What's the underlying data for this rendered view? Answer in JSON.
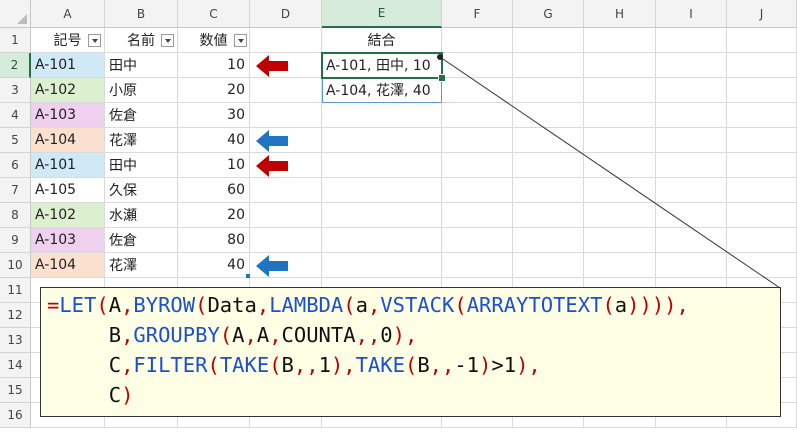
{
  "columns": [
    "A",
    "B",
    "C",
    "D",
    "E",
    "F",
    "G",
    "H",
    "I",
    "J"
  ],
  "selected_column": "E",
  "rows": [
    "1",
    "2",
    "3",
    "4",
    "5",
    "6",
    "7",
    "8",
    "9",
    "10",
    "11",
    "12",
    "13",
    "14",
    "15",
    "16"
  ],
  "selected_row": "2",
  "headers": {
    "a": "記号",
    "b": "名前",
    "c": "数値",
    "e": "結合"
  },
  "data_rows": [
    {
      "a": "A-101",
      "b": "田中",
      "c": "10"
    },
    {
      "a": "A-102",
      "b": "小原",
      "c": "20"
    },
    {
      "a": "A-103",
      "b": "佐倉",
      "c": "30"
    },
    {
      "a": "A-104",
      "b": "花澤",
      "c": "40"
    },
    {
      "a": "A-101",
      "b": "田中",
      "c": "10"
    },
    {
      "a": "A-105",
      "b": "久保",
      "c": "60"
    },
    {
      "a": "A-102",
      "b": "水瀬",
      "c": "20"
    },
    {
      "a": "A-103",
      "b": "佐倉",
      "c": "80"
    },
    {
      "a": "A-104",
      "b": "花澤",
      "c": "40"
    }
  ],
  "result": [
    "A-101, 田中, 10",
    "A-104, 花澤, 40"
  ],
  "colors": {
    "A-101": "#cfe9f6",
    "A-102": "#dcefcf",
    "A-103": "#efd0ee",
    "A-104": "#fbe0d0",
    "A-105": "#ffffff",
    "red_arrow": "#c00000",
    "blue_arrow": "#1f75c4",
    "accent": "#217346"
  },
  "formula_lines": [
    [
      [
        "p",
        "="
      ],
      [
        "f",
        "LET"
      ],
      [
        "p",
        "("
      ],
      [
        "t",
        "A"
      ],
      [
        "p",
        ","
      ],
      [
        "f",
        "BYROW"
      ],
      [
        "p",
        "("
      ],
      [
        "t",
        "Data"
      ],
      [
        "p",
        ","
      ],
      [
        "f",
        "LAMBDA"
      ],
      [
        "p",
        "("
      ],
      [
        "t",
        "a"
      ],
      [
        "p",
        ","
      ],
      [
        "f",
        "VSTACK"
      ],
      [
        "p",
        "("
      ],
      [
        "f",
        "ARRAYTOTEXT"
      ],
      [
        "p",
        "("
      ],
      [
        "t",
        "a"
      ],
      [
        "p",
        "))))"
      ],
      [
        "p",
        ","
      ]
    ],
    [
      [
        "t",
        "     B"
      ],
      [
        "p",
        ","
      ],
      [
        "f",
        "GROUPBY"
      ],
      [
        "p",
        "("
      ],
      [
        "t",
        "A"
      ],
      [
        "p",
        ","
      ],
      [
        "t",
        "A"
      ],
      [
        "p",
        ","
      ],
      [
        "t",
        "COUNTA"
      ],
      [
        "p",
        ","
      ],
      [
        "p",
        ","
      ],
      [
        "t",
        "0"
      ],
      [
        "p",
        ")"
      ],
      [
        "p",
        ","
      ]
    ],
    [
      [
        "t",
        "     C"
      ],
      [
        "p",
        ","
      ],
      [
        "f",
        "FILTER"
      ],
      [
        "p",
        "("
      ],
      [
        "f",
        "TAKE"
      ],
      [
        "p",
        "("
      ],
      [
        "t",
        "B"
      ],
      [
        "p",
        ","
      ],
      [
        "p",
        ","
      ],
      [
        "t",
        "1"
      ],
      [
        "p",
        ")"
      ],
      [
        "p",
        ","
      ],
      [
        "f",
        "TAKE"
      ],
      [
        "p",
        "("
      ],
      [
        "t",
        "B"
      ],
      [
        "p",
        ","
      ],
      [
        "p",
        ","
      ],
      [
        "t",
        "-1"
      ],
      [
        "p",
        ")"
      ],
      [
        "t",
        ">1"
      ],
      [
        "p",
        ")"
      ],
      [
        "p",
        ","
      ]
    ],
    [
      [
        "t",
        "     C"
      ],
      [
        "p",
        ")"
      ]
    ]
  ]
}
